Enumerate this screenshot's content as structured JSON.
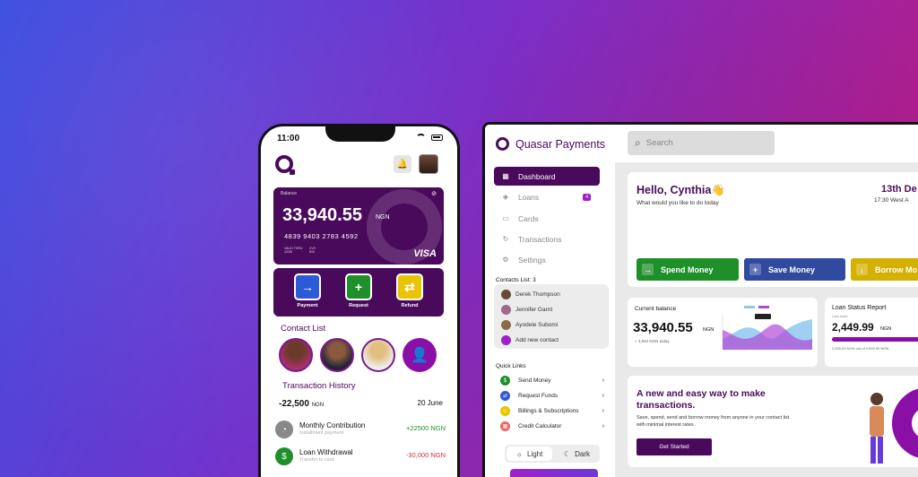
{
  "colors": {
    "brand": "#4a0a5c",
    "accent": "#a020c8",
    "green": "#1f8f2a",
    "blue": "#2b5bd6",
    "yellow": "#e9c400",
    "red": "#d32f2f"
  },
  "phone": {
    "time": "11:00",
    "card": {
      "label": "Balance",
      "amount": "33,940.55",
      "currency": "NGN",
      "number": "4839 9403 2783 4592",
      "valid_label": "VALID THRU",
      "valid_value": "12/26",
      "cvv_label": "CVV",
      "cvv_value": "815",
      "brand": "VISA"
    },
    "actions": [
      {
        "label": "Payment",
        "icon": "arrow-right-icon",
        "color": "#2b5bd6"
      },
      {
        "label": "Request",
        "icon": "plus-icon",
        "color": "#1f8f2a"
      },
      {
        "label": "Refund",
        "icon": "refund-icon",
        "color": "#e9c400"
      }
    ],
    "contact_list_title": "Contact List",
    "transaction_history_title": "Transaction History",
    "tx_summary_amount": "-22,500",
    "tx_summary_currency": "NGN",
    "tx_summary_date": "20 June",
    "transactions": [
      {
        "name": "Monthly Contribution",
        "sub": "Installment payment",
        "value": "+22500 NGN",
        "icon": "chart-icon",
        "color": "#1f8f2a",
        "icon_bg": "#888"
      },
      {
        "name": "Loan Withdrawal",
        "sub": "Transfer to card",
        "value": "-30,000 NGN",
        "icon": "dollar-icon",
        "color": "#d32f2f",
        "icon_bg": "#1f8f2a"
      }
    ]
  },
  "desktop": {
    "brand_name": "Quasar Payments",
    "nav": [
      {
        "label": "Dashboard",
        "icon": "grid-icon",
        "active": true
      },
      {
        "label": "Loans",
        "icon": "cube-icon",
        "badge": "4"
      },
      {
        "label": "Cards",
        "icon": "card-icon"
      },
      {
        "label": "Transactions",
        "icon": "history-icon"
      },
      {
        "label": "Settings",
        "icon": "gear-icon"
      }
    ],
    "contacts_title": "Contacts List: 3",
    "contacts": [
      "Derek Thompson",
      "Jennifer Garnt",
      "Ayodele Subomi"
    ],
    "add_contact": "Add new contact",
    "quick_links_title": "Quick Links",
    "quick_links": [
      {
        "label": "Send Money",
        "icon": "dollar-icon",
        "color": "#1f8f2a"
      },
      {
        "label": "Request Funds",
        "icon": "exchange-icon",
        "color": "#2b5bd6"
      },
      {
        "label": "Billings & Subscriptions",
        "icon": "smile-icon",
        "color": "#e9c400"
      },
      {
        "label": "Credit Calculator",
        "icon": "calculator-icon",
        "color": "#e66"
      }
    ],
    "theme": {
      "light": "Light",
      "dark": "Dark"
    },
    "search_placeholder": "Search",
    "greeting": {
      "title": "Hello, Cynthia👋",
      "subtitle": "What would you like to do today",
      "date": "13th De",
      "time": "17:30 West A"
    },
    "greet_buttons": [
      {
        "label": "Spend Money",
        "color": "#1f8f2a",
        "icon": "→"
      },
      {
        "label": "Save Money",
        "color": "#2f4a9e",
        "icon": "+"
      },
      {
        "label": "Borrow Mo",
        "color": "#d4b000",
        "icon": "↓"
      }
    ],
    "current_balance": {
      "title": "Current balance",
      "amount": "33,940.55",
      "currency": "NGN",
      "sub": "+ 3,940 NGN today"
    },
    "loan_status": {
      "title": "Loan Status Report",
      "sub": "Loan count",
      "amount": "2,449.99",
      "currency": "NGN",
      "progress": 0.54,
      "note": "2,000.00 NGN out of 4,500.00 NGN"
    },
    "promo": {
      "title": "A new and easy way to make transactions.",
      "text": "Save, spend, send and borrow money from anyone in your contact list with minimal interest rates .",
      "button": "Get Started"
    }
  }
}
